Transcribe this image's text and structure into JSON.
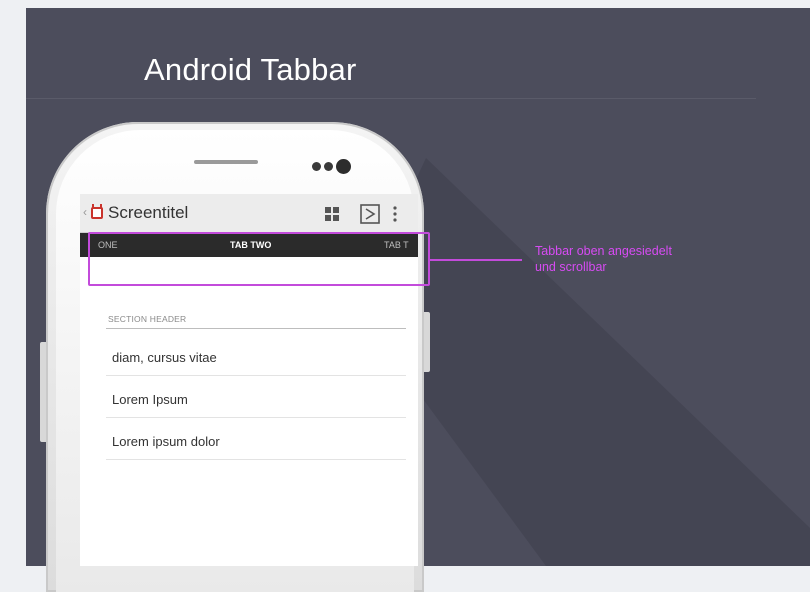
{
  "slide": {
    "title": "Android Tabbar",
    "background": "#4c4d5c"
  },
  "app": {
    "title": "Screentitel",
    "icons": [
      "app-icon",
      "grid-icon",
      "share-icon",
      "overflow-menu-icon"
    ]
  },
  "tabs": {
    "items": [
      "ONE",
      "TAB TWO",
      "TAB T"
    ],
    "selected": "TAB TWO"
  },
  "list": {
    "section_header": "SECTION HEADER",
    "items": [
      "diam, cursus vitae",
      "Lorem Ipsum",
      "Lorem ipsum dolor"
    ]
  },
  "annotation": {
    "line1": "Tabbar oben angesiedelt",
    "line2": "und scrollbar",
    "color": "#d74bf3"
  }
}
